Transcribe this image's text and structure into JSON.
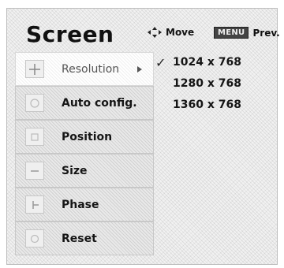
{
  "header": {
    "title": "Screen",
    "move_label": "Move",
    "menu_key": "MENU",
    "prev_label": "Prev."
  },
  "menu": {
    "items": [
      {
        "label": "Resolution",
        "icon": "resolution-icon",
        "active": true
      },
      {
        "label": "Auto config.",
        "icon": "auto-config-icon"
      },
      {
        "label": "Position",
        "icon": "position-icon"
      },
      {
        "label": "Size",
        "icon": "size-icon"
      },
      {
        "label": "Phase",
        "icon": "phase-icon"
      },
      {
        "label": "Reset",
        "icon": "reset-icon"
      }
    ]
  },
  "resolution_options": [
    {
      "label": "1024 x 768",
      "selected": true
    },
    {
      "label": "1280 x 768",
      "selected": false
    },
    {
      "label": "1360 x 768",
      "selected": false
    }
  ],
  "check_mark": "✓"
}
